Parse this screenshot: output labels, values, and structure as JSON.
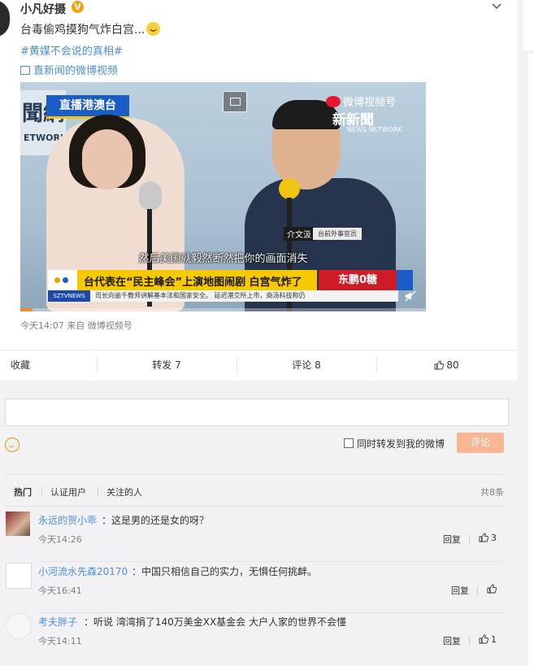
{
  "post": {
    "username": "小凡好摄",
    "verified_badge": "V",
    "text": "台毒偷鸡摸狗气炸白宫...",
    "hashtag": "#黄媒不会说的真相#",
    "video_link": "直新闻的微博视频",
    "time": "今天14:07",
    "source": "来自 微博视频号"
  },
  "video": {
    "live_badge": "直播港澳台",
    "channel_logo": "聞網",
    "channel_logo_sub": "ETWORK",
    "weibo_watermark": "微博视频号",
    "news_watermark": "新新聞",
    "news_watermark_sub": "NEWS NETWORK",
    "speaker_name": "介文汲",
    "speaker_title": "台前外事官员",
    "subtitle": "然后美国就毅然断然把你的画面消失",
    "headline": "台代表在“民主峰会”上演地图闹剧 白宫气炸了",
    "brand": "东鹏0糖",
    "ticker_tag": "SZTVNEWS",
    "ticker_text": "司长向逾千教师讲解基本法和国家安全。    延迟港交所上市，商汤科技称仍",
    "progress": 0.03
  },
  "actions": {
    "favorite": "收藏",
    "repost": "转发 7",
    "comment": "评论 8",
    "like": "80"
  },
  "comment_box": {
    "input_value": "",
    "repost_checkbox_label": "同时转发到我的微博",
    "submit": "评论"
  },
  "comment_tabs": {
    "tabs": [
      "热门",
      "认证用户",
      "关注的人"
    ],
    "count": "共8条"
  },
  "comments": [
    {
      "user": "永远的贺小乖",
      "sep": "：",
      "text": "这是男的还是女的呀？",
      "time": "今天14:26",
      "reply": "回复",
      "likes": "3"
    },
    {
      "user": "小河流水先森20170",
      "sep": "：",
      "text": "中国只相信自己的实力，无惧任何挑衅。",
      "time": "今天16:41",
      "reply": "回复",
      "likes": ""
    },
    {
      "user": "考夫胖子",
      "sep": "：",
      "text": "听说 湾湾捐了140万美金XX基金会 大户人家的世界不会懂",
      "time": "今天14:11",
      "reply": "回复",
      "likes": "1"
    }
  ],
  "colors": {
    "link": "#4d8fd6",
    "submit_bg": "#f9b695",
    "comments_bg": "#f2f2f5",
    "verified": "#f3a00c"
  }
}
